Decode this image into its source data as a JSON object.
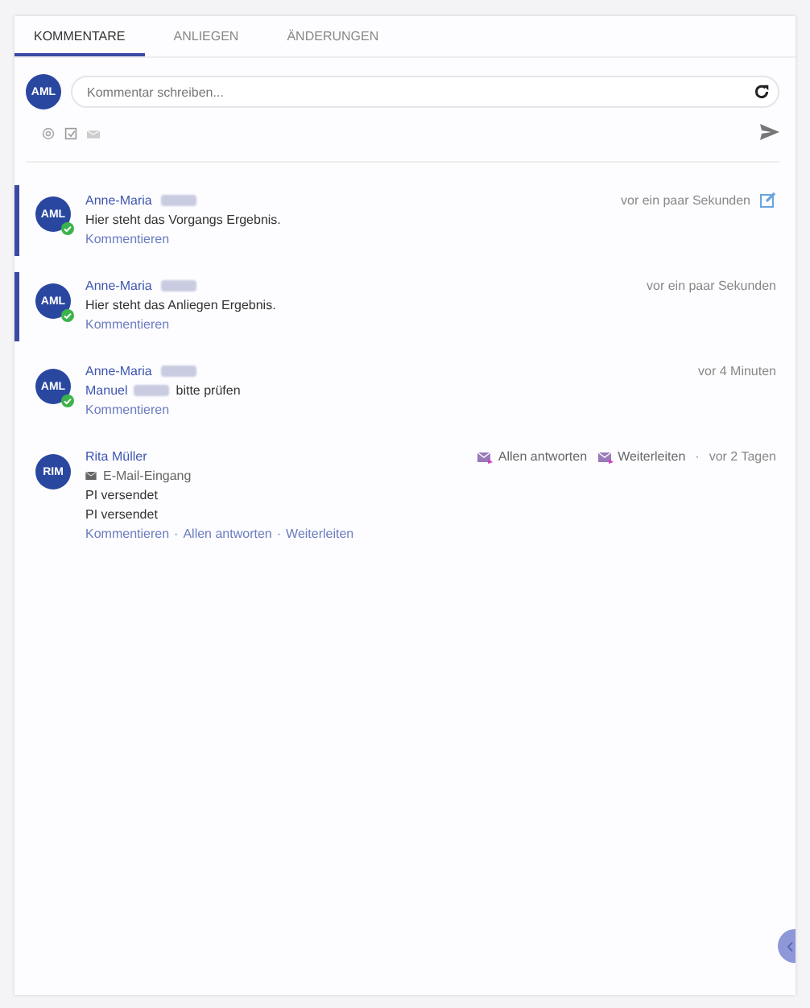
{
  "tabs": [
    {
      "label": "KOMMENTARE",
      "selected": true
    },
    {
      "label": "ANLIEGEN",
      "selected": false
    },
    {
      "label": "ÄNDERUNGEN",
      "selected": false
    }
  ],
  "composer": {
    "avatar": "AML",
    "placeholder": "Kommentar schreiben..."
  },
  "comments": [
    {
      "avatar": "AML",
      "author": "Anne-Maria",
      "author_redacted": true,
      "online": true,
      "highlighted": true,
      "time": "vor ein paar Sekunden",
      "editable": true,
      "body": [
        [
          {
            "kind": "text",
            "text": "Hier steht das Vorgangs Ergebnis."
          }
        ]
      ],
      "links": [
        "Kommentieren"
      ]
    },
    {
      "avatar": "AML",
      "author": "Anne-Maria",
      "author_redacted": true,
      "online": true,
      "highlighted": true,
      "time": "vor ein paar Sekunden",
      "editable": false,
      "body": [
        [
          {
            "kind": "text",
            "text": "Hier steht das Anliegen Ergebnis."
          }
        ]
      ],
      "links": [
        "Kommentieren"
      ]
    },
    {
      "avatar": "AML",
      "author": "Anne-Maria",
      "author_redacted": true,
      "online": true,
      "highlighted": false,
      "time": "vor 4 Minuten",
      "editable": false,
      "body": [
        [
          {
            "kind": "mention",
            "text": "Manuel"
          },
          {
            "kind": "redacted"
          },
          {
            "kind": "text",
            "text": "bitte prüfen"
          }
        ]
      ],
      "links": [
        "Kommentieren"
      ]
    },
    {
      "avatar": "RIM",
      "author": "Rita Müller",
      "author_redacted": false,
      "online": false,
      "highlighted": false,
      "time": "vor 2 Tagen",
      "editable": false,
      "actions": [
        "Allen antworten",
        "Weiterleiten"
      ],
      "separator": "·",
      "source": "E-Mail-Eingang",
      "body": [
        [
          {
            "kind": "text",
            "text": "PI versendet"
          }
        ],
        [
          {
            "kind": "text",
            "text": "PI versendet"
          }
        ]
      ],
      "links": [
        "Kommentieren",
        "Allen antworten",
        "Weiterleiten"
      ]
    }
  ]
}
